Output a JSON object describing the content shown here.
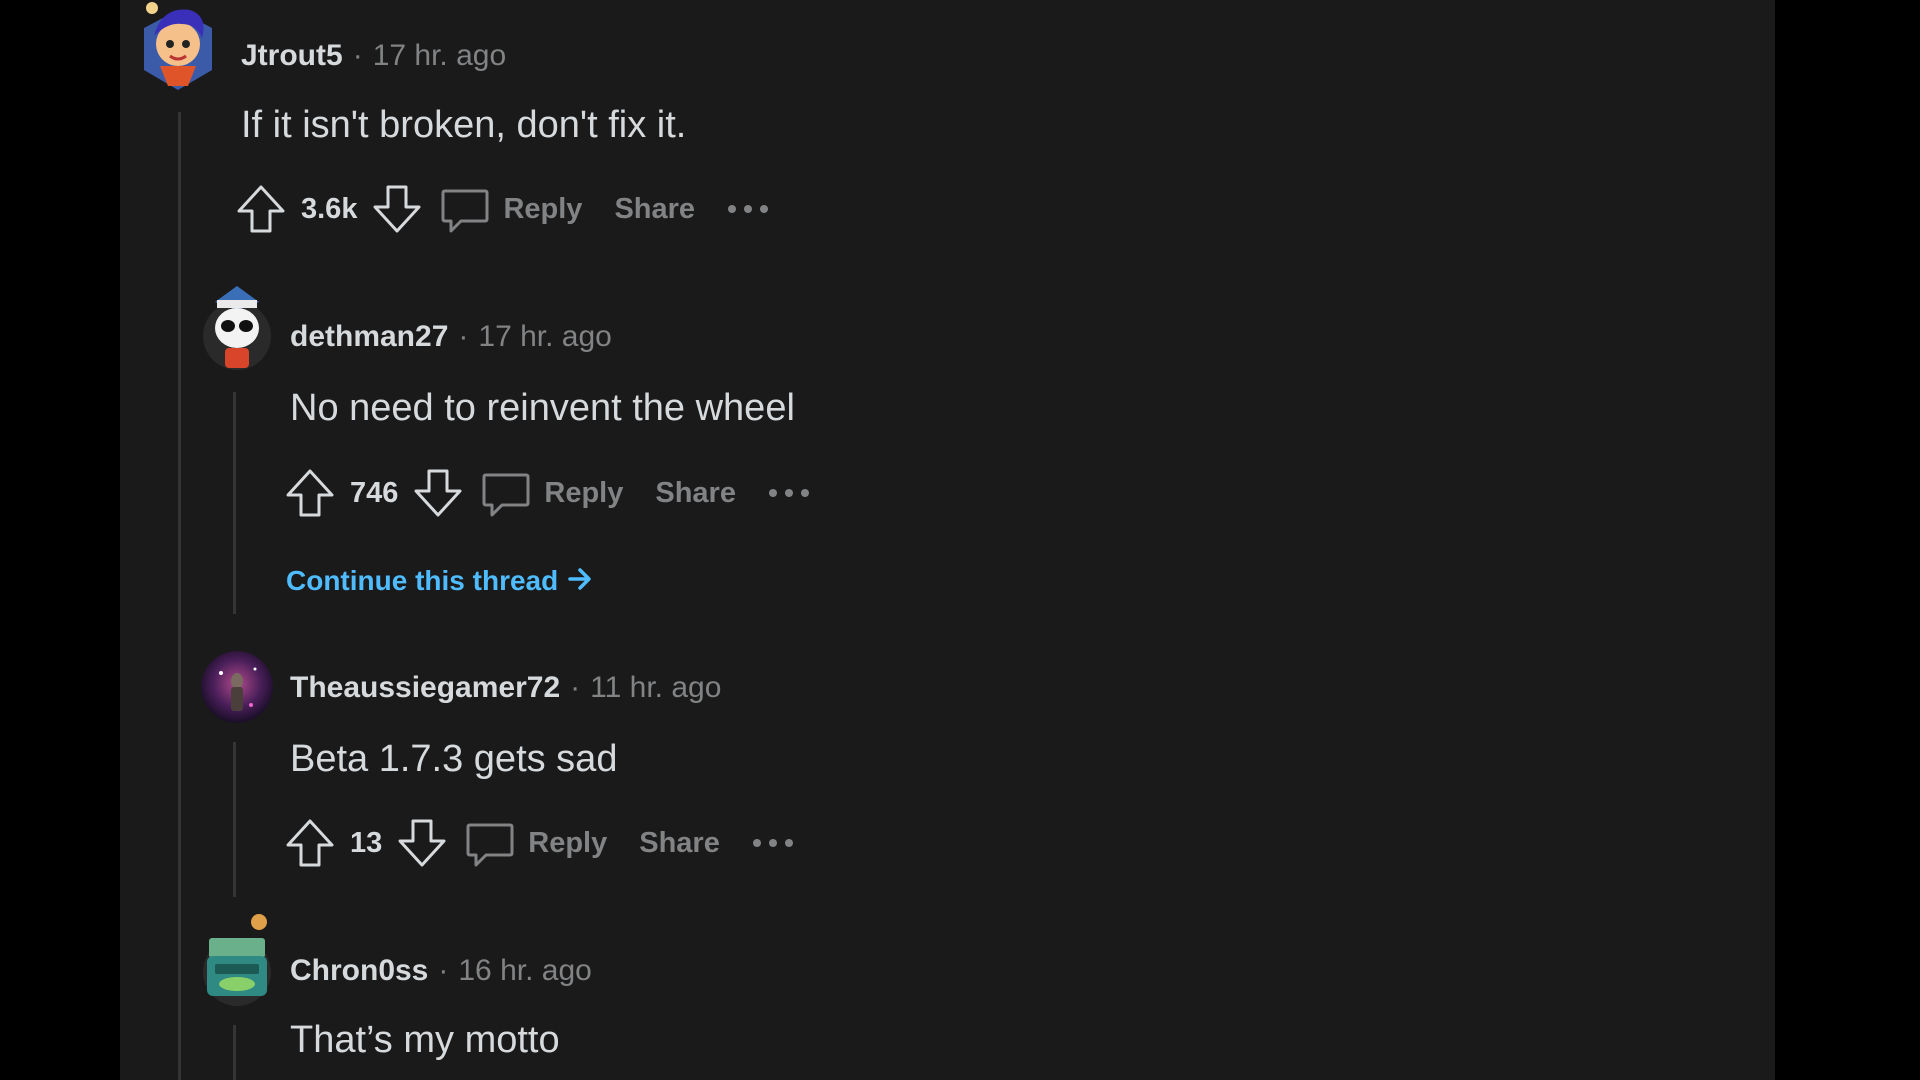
{
  "colors": {
    "background": "#1a1a1b",
    "outer": "#000000",
    "text": "#d7dadc",
    "muted": "#818384",
    "link": "#4fbcff",
    "thread_line": "#343536"
  },
  "comments": [
    {
      "author": "Jtrout5",
      "separator": "·",
      "time": "17 hr. ago",
      "body": "If it isn't broken, don't fix it.",
      "score": "3.6k",
      "reply_label": "Reply",
      "share_label": "Share",
      "avatar_icon": "avatar-jtrout5"
    },
    {
      "author": "dethman27",
      "separator": "·",
      "time": "17 hr. ago",
      "body": "No need to reinvent the wheel",
      "score": "746",
      "reply_label": "Reply",
      "share_label": "Share",
      "continue_label": "Continue this thread",
      "avatar_icon": "avatar-dethman27"
    },
    {
      "author": "Theaussiegamer72",
      "separator": "·",
      "time": "11 hr. ago",
      "body": "Beta 1.7.3 gets sad",
      "score": "13",
      "reply_label": "Reply",
      "share_label": "Share",
      "avatar_icon": "avatar-theaussiegamer72"
    },
    {
      "author": "Chron0ss",
      "separator": "·",
      "time": "16 hr. ago",
      "body": "That’s my motto",
      "avatar_icon": "avatar-chron0ss"
    }
  ]
}
